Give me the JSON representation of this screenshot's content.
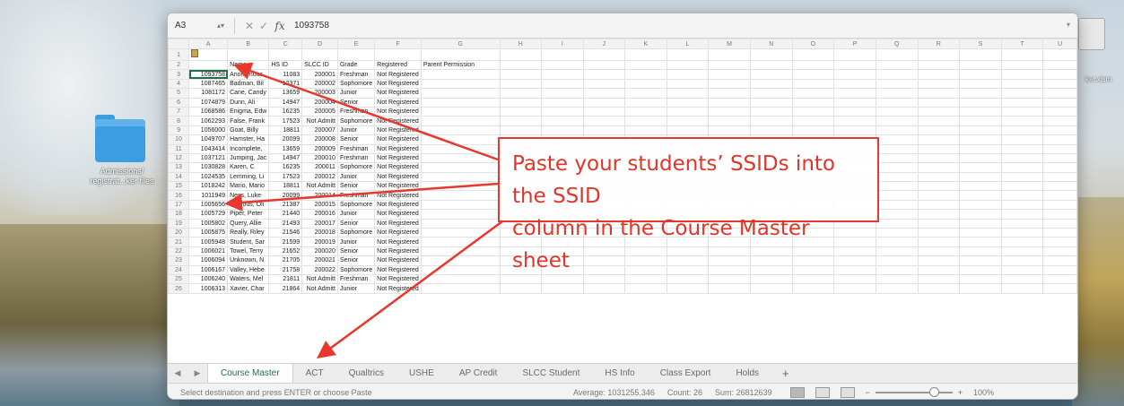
{
  "desktop": {
    "folder_label": "Admissions/\nregistrat...ker files",
    "right_label": "ker.xlsm"
  },
  "formula_bar": {
    "cell_ref": "A3",
    "value": "1093758"
  },
  "columns": [
    "A",
    "B",
    "C",
    "D",
    "E",
    "F",
    "G",
    "H",
    "I",
    "J",
    "K",
    "L",
    "M",
    "N",
    "O",
    "P",
    "Q",
    "R",
    "S",
    "T",
    "U"
  ],
  "header_row": [
    "",
    "Name",
    "HS ID",
    "SLCC ID",
    "Grade",
    "Registered",
    "Parent Permission"
  ],
  "rows": [
    [
      "1093758",
      "Anonymous",
      "11083",
      "200001",
      "Freshman",
      "Not Registered"
    ],
    [
      "1087465",
      "Badman, Bil",
      "12371",
      "200002",
      "Sophomore",
      "Not Registered"
    ],
    [
      "1081172",
      "Cane, Candy",
      "13659",
      "200003",
      "Junior",
      "Not Registered"
    ],
    [
      "1074879",
      "Dunn, Ali",
      "14947",
      "200004",
      "Senior",
      "Not Registered"
    ],
    [
      "1068586",
      "Enigma, Edw",
      "16235",
      "200005",
      "Freshman",
      "Not Registered"
    ],
    [
      "1062293",
      "False, Frank",
      "17523",
      "Not Admitt",
      "Sophomore",
      "Not Registered"
    ],
    [
      "1056000",
      "Goat, Billy",
      "18811",
      "200007",
      "Junior",
      "Not Registered"
    ],
    [
      "1049707",
      "Hamster, Ha",
      "20099",
      "200008",
      "Senior",
      "Not Registered"
    ],
    [
      "1043414",
      "Incomplete,",
      "13659",
      "200009",
      "Freshman",
      "Not Registered"
    ],
    [
      "1037121",
      "Jumping, Jac",
      "14947",
      "200010",
      "Freshman",
      "Not Registered"
    ],
    [
      "1030828",
      "Karen, C",
      "16235",
      "200011",
      "Sophomore",
      "Not Registered"
    ],
    [
      "1024535",
      "Lemming, Li",
      "17523",
      "200012",
      "Junior",
      "Not Registered"
    ],
    [
      "1018242",
      "Mario, Mario",
      "18811",
      "Not Admitt",
      "Senior",
      "Not Registered"
    ],
    [
      "1011949",
      "Ness, Luke",
      "20099",
      "200014",
      "Freshman",
      "Not Registered"
    ],
    [
      "1005656",
      "Obvious, Oli",
      "21387",
      "200015",
      "Sophomore",
      "Not Registered"
    ],
    [
      "1005729",
      "Piper, Peter",
      "21440",
      "200016",
      "Junior",
      "Not Registered"
    ],
    [
      "1005802",
      "Query, Allie",
      "21493",
      "200017",
      "Senior",
      "Not Registered"
    ],
    [
      "1005875",
      "Really, Riley",
      "21546",
      "200018",
      "Sophomore",
      "Not Registered"
    ],
    [
      "1005948",
      "Student, Sar",
      "21599",
      "200019",
      "Junior",
      "Not Registered"
    ],
    [
      "1006021",
      "Towel, Terry",
      "21652",
      "200020",
      "Senior",
      "Not Registered"
    ],
    [
      "1006094",
      "Unknown, N",
      "21705",
      "200021",
      "Senior",
      "Not Registered"
    ],
    [
      "1006167",
      "Valley, Hebe",
      "21758",
      "200022",
      "Sophomore",
      "Not Registered"
    ],
    [
      "1006240",
      "Waters, Mel",
      "21811",
      "Not Admitt",
      "Freshman",
      "Not Registered"
    ],
    [
      "1006313",
      "Xavier, Char",
      "21864",
      "Not Admitt",
      "Junior",
      "Not Registered"
    ]
  ],
  "sheet_tabs": [
    "Course Master",
    "ACT",
    "Qualtrics",
    "USHE",
    "AP Credit",
    "SLCC Student",
    "HS Info",
    "Class Export",
    "Holds"
  ],
  "active_tab": "Course Master",
  "status_bar": {
    "message": "Select destination and press ENTER or choose Paste",
    "average": "Average: 1031255.346",
    "count": "Count: 26",
    "sum": "Sum: 26812639",
    "zoom": "100%"
  },
  "annotation": {
    "line1": "Paste your students’ SSIDs into the SSID",
    "line2": "column in the Course Master sheet",
    "color": "#e03529"
  }
}
